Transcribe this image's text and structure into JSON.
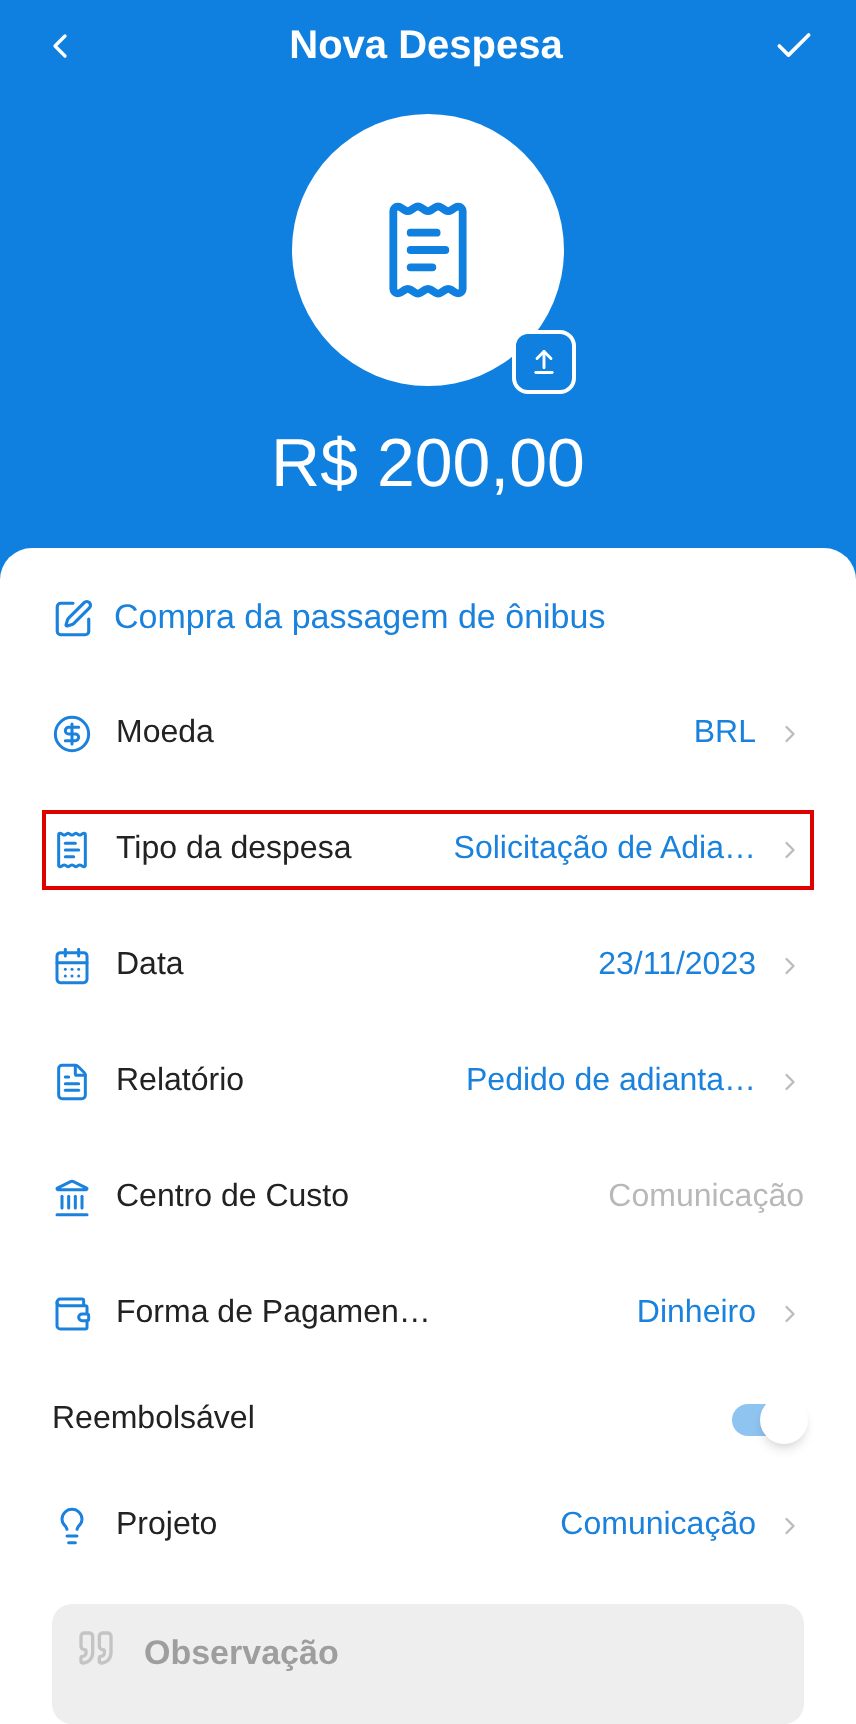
{
  "header": {
    "title": "Nova Despesa",
    "amount": "R$ 200,00"
  },
  "description": "Compra da passagem de ônibus",
  "rows": [
    {
      "kind": "field",
      "label": "Moeda",
      "value": "BRL",
      "disabled": false,
      "highlighted": false
    },
    {
      "kind": "field",
      "label": "Tipo da despesa",
      "value": "Solicitação de Adia…",
      "disabled": false,
      "highlighted": true
    },
    {
      "kind": "field",
      "label": "Data",
      "value": "23/11/2023",
      "disabled": false,
      "highlighted": false
    },
    {
      "kind": "field",
      "label": "Relatório",
      "value": "Pedido de adianta…",
      "disabled": false,
      "highlighted": false
    },
    {
      "kind": "field",
      "label": "Centro de Custo",
      "value": "Comunicação",
      "disabled": true,
      "highlighted": false
    },
    {
      "kind": "field",
      "label": "Forma de Pagamen…",
      "value": "Dinheiro",
      "disabled": false,
      "highlighted": false
    },
    {
      "kind": "toggle",
      "label": "Reembolsável",
      "on": true
    },
    {
      "kind": "field",
      "label": "Projeto",
      "value": "Comunicação",
      "disabled": false,
      "highlighted": false
    }
  ],
  "note": {
    "placeholder": "Observação"
  }
}
